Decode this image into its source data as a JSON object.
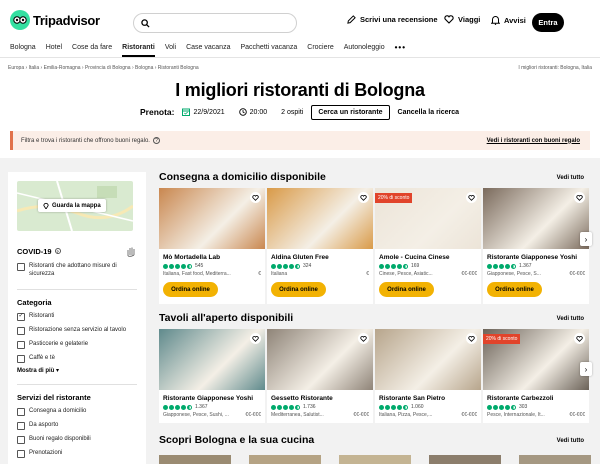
{
  "header": {
    "logo": "Tripadvisor",
    "write_review": "Scrivi una recensione",
    "trips": "Viaggi",
    "alerts": "Avvisi",
    "login": "Entra"
  },
  "nav": {
    "items": [
      "Bologna",
      "Hotel",
      "Cose da fare",
      "Ristoranti",
      "Voli",
      "Case vacanza",
      "Pacchetti vacanza",
      "Crociere",
      "Autonoleggio"
    ],
    "active": "Ristoranti",
    "more": "•••"
  },
  "breadcrumbs": "Europa › Italia › Emilia-Romagna › Provincia di Bologna › Bologna › Ristoranti Bologna",
  "breadcrumbs_right": "I migliori ristoranti: Bologna, Italia",
  "title": "I migliori ristoranti di Bologna",
  "booking": {
    "label": "Prenota:",
    "date": "22/9/2021",
    "time": "20:00",
    "guests": "2 ospiti",
    "search_btn": "Cerca un ristorante",
    "cancel": "Cancella la ricerca"
  },
  "banner": {
    "text": "Filtra e trova i ristoranti che offrono buoni regalo.",
    "link": "Vedi i ristoranti con buoni regalo"
  },
  "sidebar": {
    "map_btn": "Guarda la mappa",
    "covid_title": "COVID-19",
    "covid_option": "Ristoranti che adottano misure di sicurezza",
    "category_title": "Categoria",
    "categories": [
      "Ristoranti",
      "Ristorazione senza servizio al tavolo",
      "Pasticcerie e gelaterie",
      "Caffè e tè"
    ],
    "show_more": "Mostra di più",
    "services_title": "Servizi del ristorante",
    "services": [
      "Consegna a domicilio",
      "Da asporto",
      "Buoni regalo disponibili",
      "Prenotazioni"
    ]
  },
  "sections": {
    "delivery": {
      "title": "Consegna a domicilio disponibile",
      "see_all": "Vedi tutto",
      "cards": [
        {
          "name": "Mò Mortadella Lab",
          "reviews": "545",
          "cuisine": "Italiana, Fast food, Mediterra...",
          "price": "€",
          "order": "Ordina online",
          "promo": "",
          "img": "#c9874f"
        },
        {
          "name": "Aldina Gluten Free",
          "reviews": "324",
          "cuisine": "Italiana",
          "price": "€",
          "order": "Ordina online",
          "promo": "",
          "img": "#d99a48"
        },
        {
          "name": "Amole - Cucina Cinese",
          "reviews": "169",
          "cuisine": "Cinese, Pesce, Asiatic...",
          "price": "€€-€€€",
          "order": "Ordina online",
          "promo": "20% di sconto",
          "img": "#ece4d8"
        },
        {
          "name": "Ristorante Giapponese Yoshi",
          "reviews": "1.367",
          "cuisine": "Giapponese, Pesce, S...",
          "price": "€€-€€€",
          "order": "Ordina online",
          "promo": "",
          "img": "#7a6a5c"
        }
      ]
    },
    "outdoor": {
      "title": "Tavoli all'aperto disponibili",
      "see_all": "Vedi tutto",
      "cards": [
        {
          "name": "Ristorante Giapponese Yoshi",
          "reviews": "1.367",
          "cuisine": "Giapponese, Pesce, Sushi, ...",
          "price": "€€-€€€",
          "promo": "",
          "img": "#5f8a8c"
        },
        {
          "name": "Gessetto Ristorante",
          "reviews": "1.736",
          "cuisine": "Mediterranea, Salutist...",
          "price": "€€-€€€",
          "promo": "",
          "img": "#8f8478"
        },
        {
          "name": "Ristorante San Pietro",
          "reviews": "1.060",
          "cuisine": "Italiana, Pizza, Pesce,...",
          "price": "€€-€€€",
          "promo": "",
          "img": "#b7a58c"
        },
        {
          "name": "Ristorante Carbezzoli",
          "reviews": "303",
          "cuisine": "Pesce, Internazionale, It...",
          "price": "€€-€€€",
          "promo": "20% di sconto",
          "img": "#6b6258"
        }
      ]
    },
    "discover": {
      "title": "Scopri Bologna e la sua cucina",
      "see_all": "Vedi tutto"
    }
  },
  "colors": {
    "brand_green": "#34e0a1",
    "rating_green": "#00aa6c",
    "order_yellow": "#f2b203",
    "promo_red": "#e1442b"
  }
}
